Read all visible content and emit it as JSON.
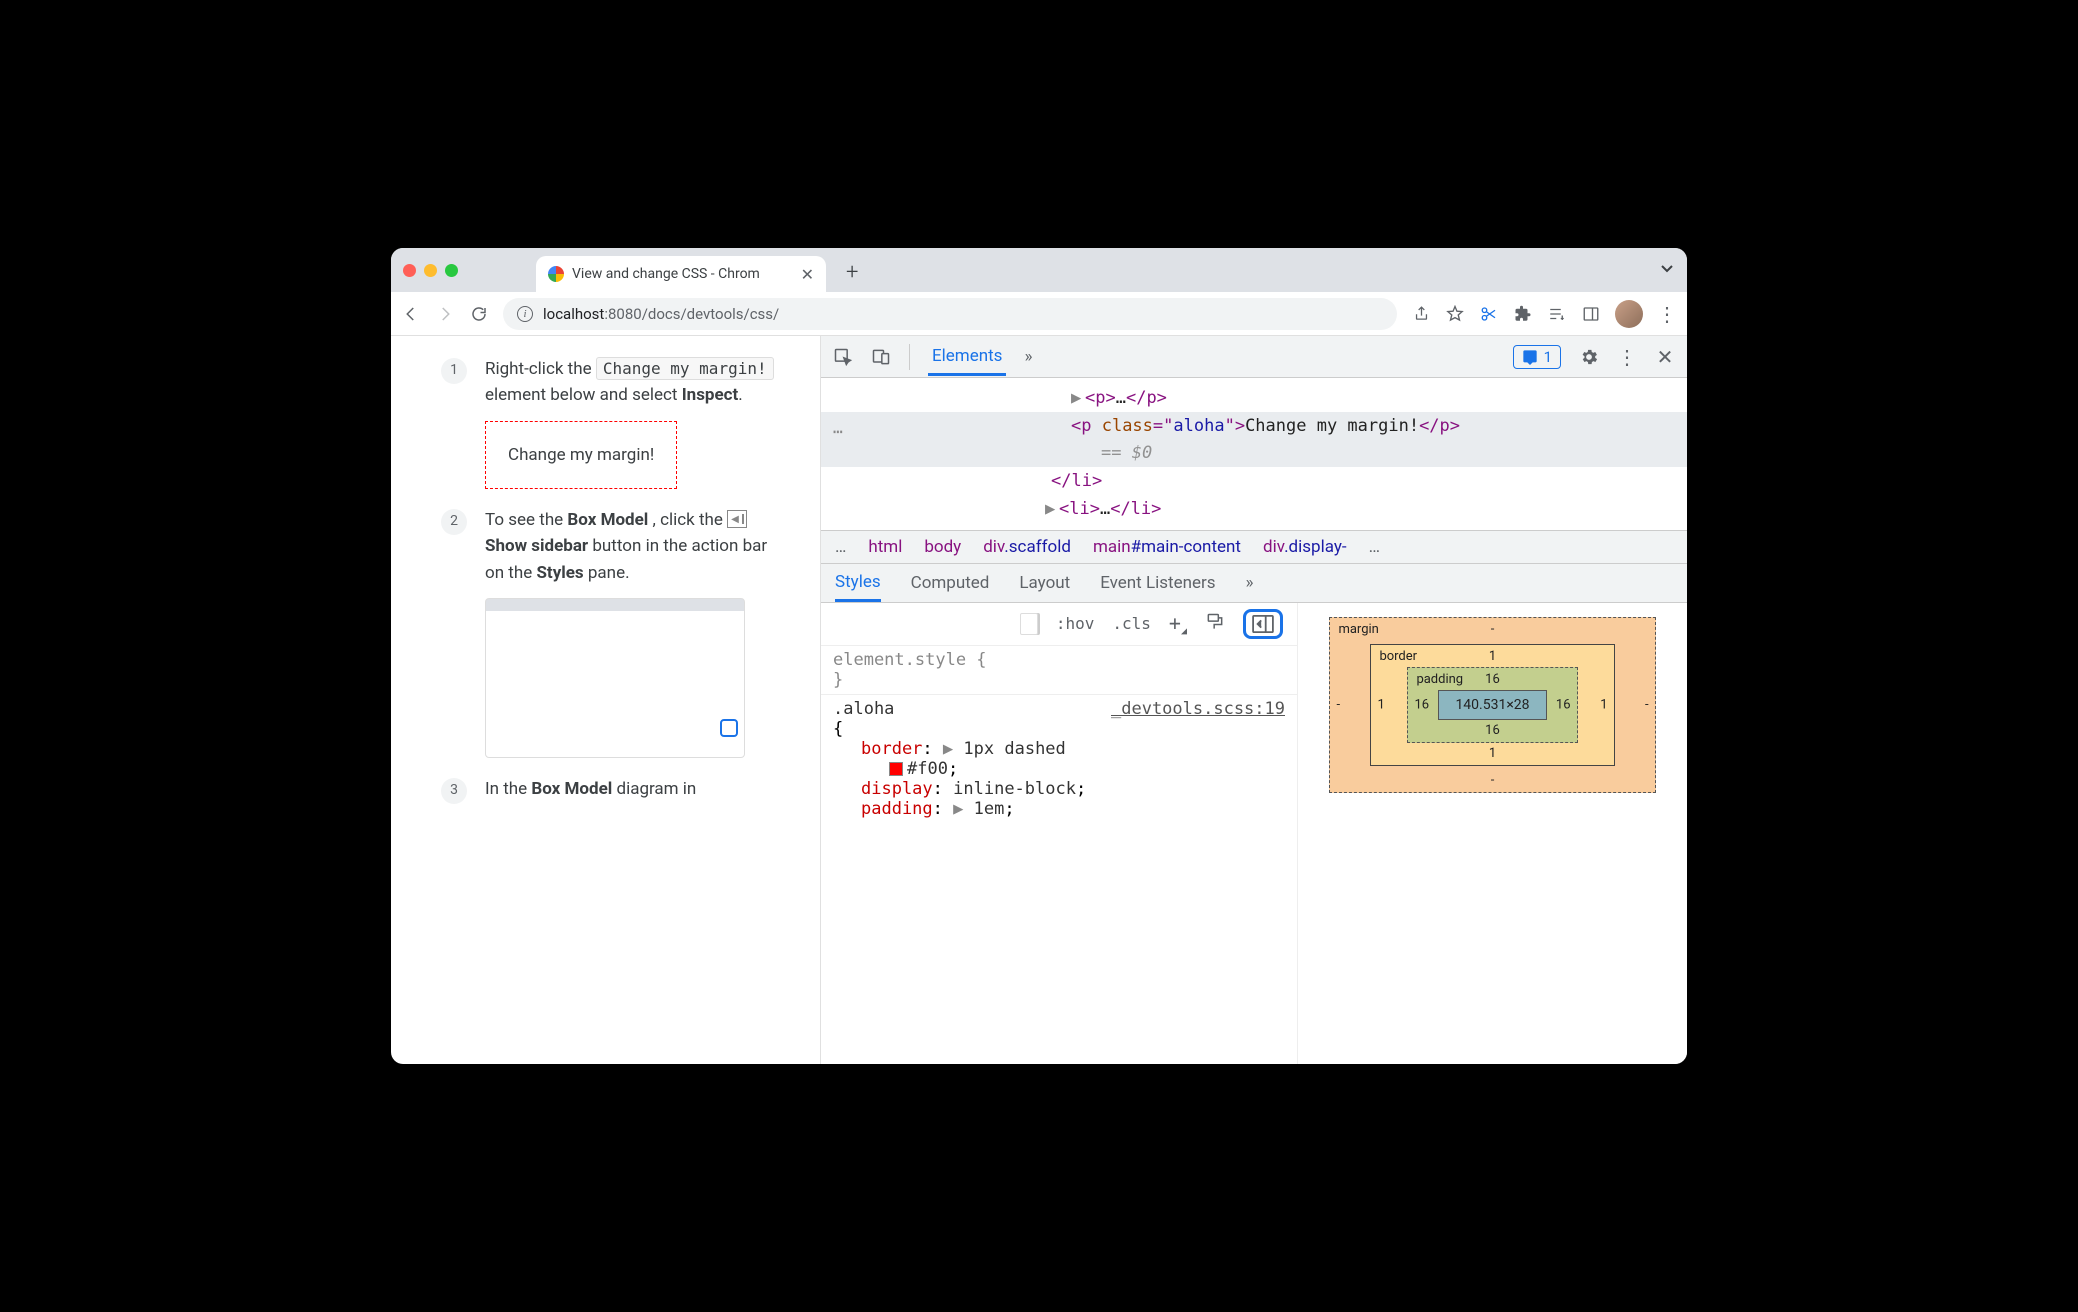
{
  "browser": {
    "tab_title": "View and change CSS - Chrom",
    "url": {
      "scheme_icon": "i",
      "host": "localhost",
      "port": ":8080",
      "path": "/docs/devtools/css/"
    }
  },
  "page": {
    "step1": {
      "num": "1",
      "pre": "Right-click the ",
      "code": "Change my margin!",
      "post": " element below and select ",
      "bold": "Inspect",
      "period": ".",
      "demo": "Change my margin!"
    },
    "step2": {
      "num": "2",
      "text1": "To see the ",
      "bold1": "Box Model",
      "text2": ", click the ",
      "bold2": "Show sidebar",
      "text3": " button in the action bar on the ",
      "bold3": "Styles",
      "text4": " pane."
    },
    "step3": {
      "num": "3",
      "text1": "In the ",
      "bold1": "Box Model",
      "text2": " diagram in"
    }
  },
  "devtools": {
    "top": {
      "elements": "Elements",
      "issues_count": "1"
    },
    "dom": {
      "row1": "<p>…</p>",
      "row2_open": "<p class=\"aloha\">",
      "row2_text": "Change my margin!",
      "row2_close": "</p>",
      "row2_sel": "== $0",
      "row3": "</li>",
      "row4": "<li>…</li>"
    },
    "crumbs": {
      "ellipsis": "…",
      "items": [
        "html",
        "body",
        "div.scaffold",
        "main#main-content",
        "div.display-"
      ]
    },
    "subtabs": [
      "Styles",
      "Computed",
      "Layout",
      "Event Listeners"
    ],
    "styles_toolbar": {
      "hov": ":hov",
      "cls": ".cls"
    },
    "rules": {
      "element_style": "element.style {",
      "close": "}",
      "aloha_sel": ".aloha",
      "aloha_src": "_devtools.scss:19",
      "open": "{",
      "border_prop": "border",
      "border_val1": "1px dashed",
      "border_val2": "#f00",
      "display_prop": "display",
      "display_val": "inline-block",
      "padding_prop": "padding",
      "padding_val": "1em"
    },
    "box_model": {
      "margin_label": "margin",
      "border_label": "border",
      "padding_label": "padding",
      "content": "140.531×28",
      "margin": {
        "t": "-",
        "r": "-",
        "b": "-",
        "l": "-"
      },
      "border": {
        "t": "1",
        "r": "1",
        "b": "1",
        "l": "1"
      },
      "padding": {
        "t": "16",
        "r": "16",
        "b": "16",
        "l": "16"
      }
    }
  }
}
